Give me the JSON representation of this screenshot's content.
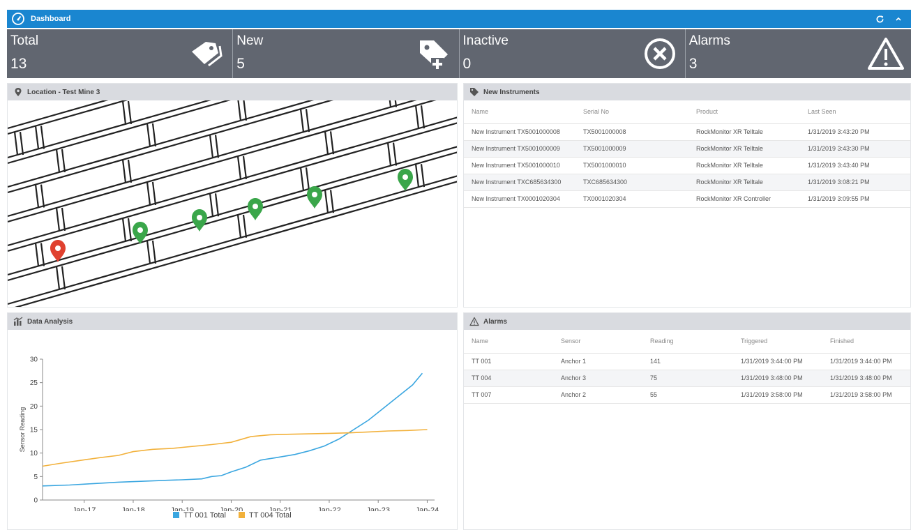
{
  "topbar": {
    "title": "Dashboard",
    "refresh_icon": "refresh-icon",
    "collapse_icon": "chevron-up-icon"
  },
  "stats": [
    {
      "label": "Total",
      "value": "13",
      "icon": "tags-icon"
    },
    {
      "label": "New",
      "value": "5",
      "icon": "tag-add-icon"
    },
    {
      "label": "Inactive",
      "value": "0",
      "icon": "close-circle-icon"
    },
    {
      "label": "Alarms",
      "value": "3",
      "icon": "warning-icon"
    }
  ],
  "location": {
    "title": "Location - Test Mine 3"
  },
  "instruments": {
    "title": "New Instruments",
    "columns": [
      "Name",
      "Serial No",
      "Product",
      "Last Seen"
    ],
    "rows": [
      [
        "New Instrument TX5001000008",
        "TX5001000008",
        "RockMonitor XR Telltale",
        "1/31/2019 3:43:20 PM"
      ],
      [
        "New Instrument TX5001000009",
        "TX5001000009",
        "RockMonitor XR Telltale",
        "1/31/2019 3:43:30 PM"
      ],
      [
        "New Instrument TX5001000010",
        "TX5001000010",
        "RockMonitor XR Telltale",
        "1/31/2019 3:43:40 PM"
      ],
      [
        "New Instrument TXC685634300",
        "TXC685634300",
        "RockMonitor XR Telltale",
        "1/31/2019 3:08:21 PM"
      ],
      [
        "New Instrument TX0001020304",
        "TX0001020304",
        "RockMonitor XR Controller",
        "1/31/2019 3:09:55 PM"
      ]
    ]
  },
  "analysis": {
    "title": "Data Analysis"
  },
  "alarms": {
    "title": "Alarms",
    "columns": [
      "Name",
      "Sensor",
      "Reading",
      "Triggered",
      "Finished"
    ],
    "rows": [
      [
        "TT 001",
        "Anchor 1",
        "141",
        "1/31/2019 3:44:00 PM",
        "1/31/2019 3:44:00 PM"
      ],
      [
        "TT 004",
        "Anchor 3",
        "75",
        "1/31/2019 3:48:00 PM",
        "1/31/2019 3:48:00 PM"
      ],
      [
        "TT 007",
        "Anchor 2",
        "55",
        "1/31/2019 3:58:00 PM",
        "1/31/2019 3:58:00 PM"
      ]
    ]
  },
  "colors": {
    "accent": "#1a86d0",
    "stats_bg": "#616670",
    "series_1": "#3aa6e0",
    "series_2": "#f2b13b",
    "marker_ok": "#3aa64a",
    "marker_alarm": "#e0412f"
  },
  "chart_data": {
    "type": "line",
    "xlabel": "",
    "ylabel": "Sensor Reading",
    "ylim": [
      0,
      30
    ],
    "yticks": [
      "0",
      "5",
      "10",
      "15",
      "20",
      "25",
      "30"
    ],
    "xticks": [
      "Jan-17",
      "Jan-18",
      "Jan-19",
      "Jan-20",
      "Jan-21",
      "Jan-22",
      "Jan-23",
      "Jan-24"
    ],
    "xtick_pos": [
      17,
      18,
      19,
      20,
      21,
      22,
      23,
      24
    ],
    "xlim": [
      16.15,
      24.15
    ],
    "legend": "bottom",
    "series": [
      {
        "name": "TT 001 Total",
        "x": [
          16.15,
          16.7,
          17.2,
          17.7,
          18.2,
          18.7,
          19.0,
          19.4,
          19.6,
          19.8,
          20.0,
          20.3,
          20.6,
          20.9,
          21.3,
          21.6,
          21.9,
          22.2,
          22.5,
          22.8,
          23.1,
          23.4,
          23.7,
          23.9
        ],
        "y": [
          3.0,
          3.2,
          3.5,
          3.8,
          4.0,
          4.2,
          4.3,
          4.5,
          5.0,
          5.2,
          6.0,
          7.0,
          8.5,
          9.0,
          9.7,
          10.5,
          11.5,
          13.0,
          15.0,
          17.0,
          19.5,
          22.0,
          24.5,
          27.0
        ]
      },
      {
        "name": "TT 004 Total",
        "x": [
          16.15,
          16.5,
          16.9,
          17.3,
          17.7,
          18.0,
          18.4,
          18.8,
          19.2,
          19.6,
          20.0,
          20.4,
          20.8,
          21.2,
          21.6,
          22.0,
          22.4,
          22.8,
          23.2,
          23.6,
          24.0
        ],
        "y": [
          7.2,
          7.8,
          8.4,
          9.0,
          9.5,
          10.3,
          10.8,
          11.0,
          11.4,
          11.8,
          12.3,
          13.5,
          13.9,
          14.0,
          14.1,
          14.2,
          14.3,
          14.5,
          14.7,
          14.8,
          15.0
        ]
      }
    ]
  }
}
